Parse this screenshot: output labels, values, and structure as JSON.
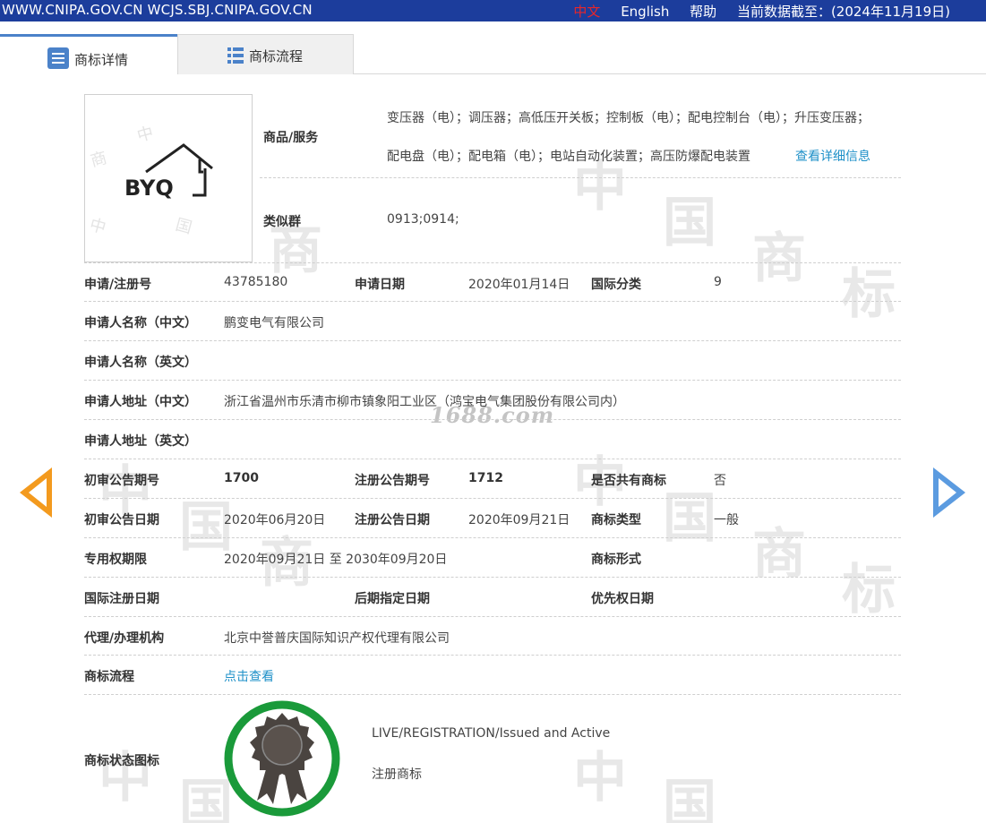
{
  "topbar": {
    "site": "WWW.CNIPA.GOV.CN WCJS.SBJ.CNIPA.GOV.CN",
    "lang_zh": "中文",
    "lang_en": "English",
    "help": "帮助",
    "data_date": "当前数据截至：(2024年11月19日)"
  },
  "tabs": [
    {
      "label": "商标详情",
      "icon": "list-doc-icon",
      "active": true
    },
    {
      "label": "商标流程",
      "icon": "list-icon",
      "active": false
    }
  ],
  "watermark": {
    "site_mark": "1688.com",
    "glyphs": [
      "中",
      "国",
      "商",
      "标"
    ]
  },
  "logo": {
    "text": "BYQ",
    "icon": "house-outline-icon"
  },
  "goods": {
    "label": "商品/服务",
    "line1": "变压器（电）；调压器；高低压开关板；控制板（电）；配电控制台（电）；升压变压器；",
    "line2": "配电盘（电）；配电箱（电）；电站自动化装置；高压防爆配电装置",
    "details_link": "查看详细信息"
  },
  "similar_group": {
    "label": "类似群",
    "value": "0913;0914;"
  },
  "rows": {
    "reg_no_label": "申请/注册号",
    "reg_no": "43785180",
    "apply_date_label": "申请日期",
    "apply_date": "2020年01月14日",
    "intl_class_label": "国际分类",
    "intl_class": "9",
    "applicant_cn_label": "申请人名称（中文）",
    "applicant_cn": "鹏变电气有限公司",
    "applicant_en_label": "申请人名称（英文）",
    "applicant_en": "",
    "address_cn_label": "申请人地址（中文）",
    "address_cn": "浙江省温州市乐清市柳市镇象阳工业区（鸿宝电气集团股份有限公司内）",
    "address_en_label": "申请人地址（英文）",
    "address_en": "",
    "prelim_no_label": "初审公告期号",
    "prelim_no": "1700",
    "reg_pub_no_label": "注册公告期号",
    "reg_pub_no": "1712",
    "shared_label": "是否共有商标",
    "shared": "否",
    "prelim_date_label": "初审公告日期",
    "prelim_date": "2020年06月20日",
    "reg_pub_date_label": "注册公告日期",
    "reg_pub_date": "2020年09月21日",
    "mark_type_label": "商标类型",
    "mark_type": "一般",
    "exclusive_label": "专用权期限",
    "exclusive": "2020年09月21日 至 2030年09月20日",
    "mark_form_label": "商标形式",
    "mark_form": "",
    "intl_reg_date_label": "国际注册日期",
    "later_designation_label": "后期指定日期",
    "priority_date_label": "优先权日期",
    "agent_label": "代理/办理机构",
    "agent": "北京中誉普庆国际知识产权代理有限公司",
    "process_label": "商标流程",
    "process_link": "点击查看",
    "status_icon_label": "商标状态图标",
    "status_en": "LIVE/REGISTRATION/Issued and Active",
    "status_cn": "注册商标"
  },
  "colors": {
    "topbar": "#1c3d9c",
    "tab_accent": "#4b82c9",
    "link": "#1e90c8",
    "arrow_prev": "#f39a1e",
    "arrow_next": "#5b9be0",
    "badge_ring": "#1a9a3a",
    "badge_seal": "#4a4440"
  }
}
